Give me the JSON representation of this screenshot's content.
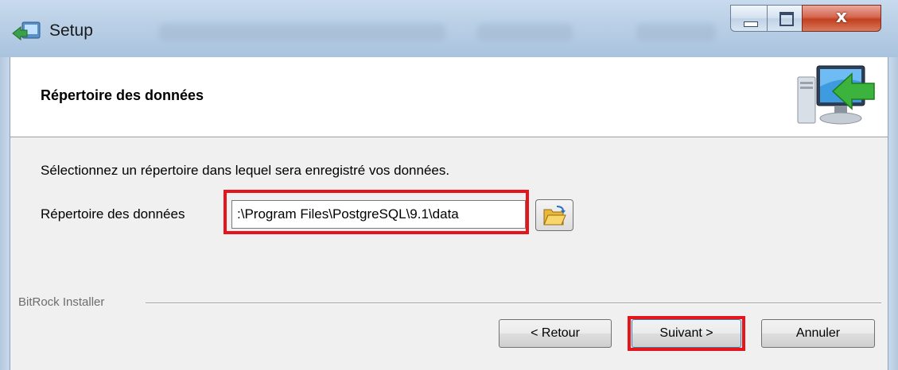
{
  "window": {
    "title": "Setup",
    "app_icon": "setup-installer-icon",
    "controls": {
      "minimize": "minimize-icon",
      "maximize": "maximize-icon",
      "close": "close-icon",
      "close_glyph": "x"
    }
  },
  "header": {
    "title": "Répertoire des données",
    "icon": "computer-arrow-icon"
  },
  "body": {
    "description": "Sélectionnez un répertoire dans lequel sera enregistré vos données.",
    "field_label": "Répertoire des données",
    "field_value": ":\\Program Files\\PostgreSQL\\9.1\\data",
    "browse_icon": "folder-open-icon"
  },
  "footer": {
    "brand": "BitRock Installer",
    "back_label": "< Retour",
    "next_label": "Suivant >",
    "cancel_label": "Annuler"
  },
  "colors": {
    "highlight": "#e8141c",
    "titlebar": "#b9cfe6",
    "client_bg": "#f0f0f0",
    "close_button": "#c2401f"
  }
}
